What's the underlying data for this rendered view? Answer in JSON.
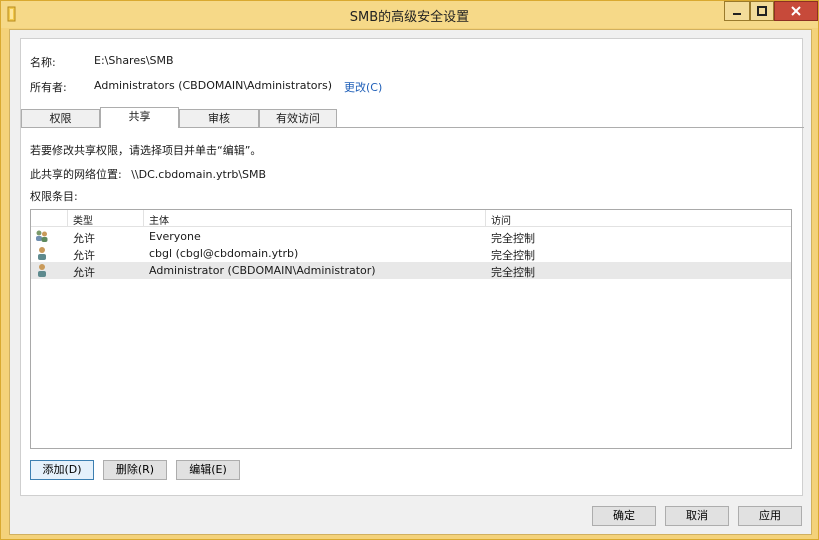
{
  "window": {
    "title": "SMB的高级安全设置"
  },
  "info": {
    "name_label": "名称:",
    "name_value": "E:\\Shares\\SMB",
    "owner_label": "所有者:",
    "owner_value": "Administrators (CBDOMAIN\\Administrators)",
    "owner_change_link": "更改(C)"
  },
  "tabs": [
    {
      "label": "权限"
    },
    {
      "label": "共享"
    },
    {
      "label": "审核"
    },
    {
      "label": "有效访问"
    }
  ],
  "active_tab": "共享",
  "share": {
    "instruction": "若要修改共享权限，请选择项目并单击“编辑”。",
    "network_location_label": "此共享的网络位置:",
    "network_location_value": "\\\\DC.cbdomain.ytrb\\SMB",
    "entries_label": "权限条目:"
  },
  "list": {
    "columns": [
      "类型",
      "主体",
      "访问"
    ],
    "rows": [
      {
        "type": "允许",
        "principal": "Everyone",
        "access": "完全控制",
        "icon": "group-users-icon"
      },
      {
        "type": "允许",
        "principal": "cbgl (cbgl@cbdomain.ytrb)",
        "access": "完全控制",
        "icon": "user-icon"
      },
      {
        "type": "允许",
        "principal": "Administrator (CBDOMAIN\\Administrator)",
        "access": "完全控制",
        "icon": "user-icon",
        "selected": true
      }
    ]
  },
  "buttons": {
    "add": "添加(D)",
    "remove": "删除(R)",
    "edit": "编辑(E)",
    "ok": "确定",
    "cancel": "取消",
    "apply": "应用"
  },
  "colors": {
    "title_bar": "#f6d988",
    "close_button": "#c74a3a",
    "link": "#1f5fb8",
    "selected_row": "#e8e8e8"
  }
}
